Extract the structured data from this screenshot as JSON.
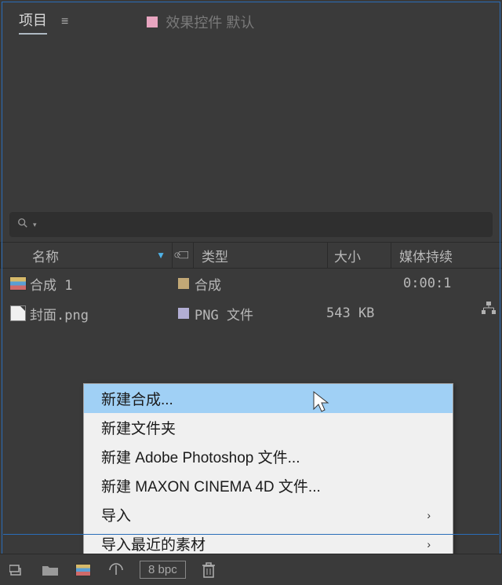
{
  "tabs": {
    "active": "项目",
    "inactive": "效果控件 默认"
  },
  "search": {
    "placeholder": ""
  },
  "columns": {
    "name": "名称",
    "type": "类型",
    "size": "大小",
    "media": "媒体持续"
  },
  "items": [
    {
      "name": "合成 1",
      "type": "合成",
      "size": "",
      "media": "0:00:1",
      "tagColor": "tan"
    },
    {
      "name": "封面.png",
      "type": "PNG 文件",
      "size": "543 KB",
      "media": "",
      "tagColor": "lavender"
    }
  ],
  "contextMenu": [
    {
      "label": "新建合成...",
      "highlighted": true,
      "submenu": false
    },
    {
      "label": "新建文件夹",
      "highlighted": false,
      "submenu": false
    },
    {
      "label": "新建 Adobe Photoshop 文件...",
      "highlighted": false,
      "submenu": false
    },
    {
      "label": "新建 MAXON CINEMA 4D 文件...",
      "highlighted": false,
      "submenu": false
    },
    {
      "label": "导入",
      "highlighted": false,
      "submenu": true
    },
    {
      "label": "导入最近的素材",
      "highlighted": false,
      "submenu": true
    }
  ],
  "bottomBar": {
    "bpc": "8 bpc"
  }
}
